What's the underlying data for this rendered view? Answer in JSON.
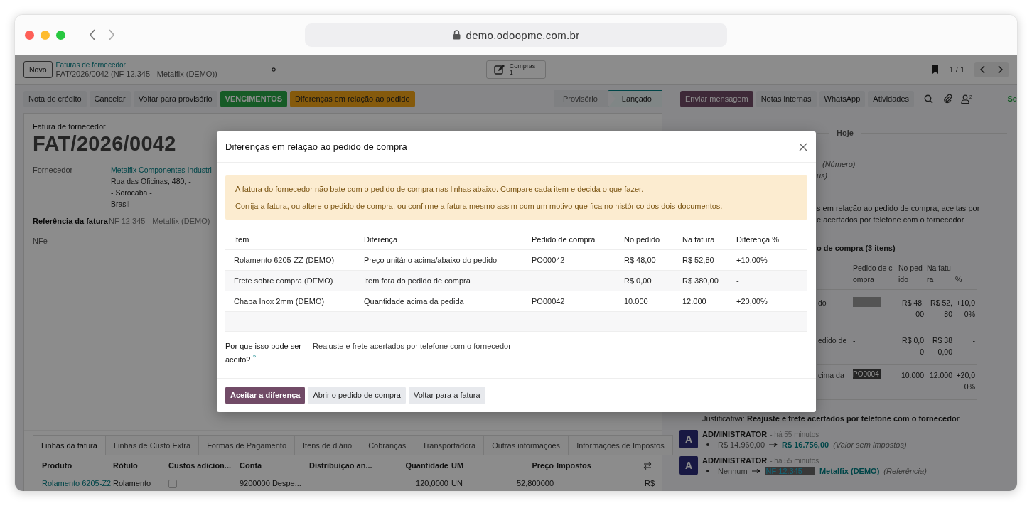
{
  "browser": {
    "url": "demo.odoopme.com.br"
  },
  "control_panel": {
    "new_button": "Novo",
    "breadcrumb": "Faturas de fornecedor",
    "record": "FAT/2026/0042 (NF 12.345 - Metalfix (DEMO))",
    "smart_button": {
      "label": "Compras",
      "count": "1"
    },
    "pager": "1 / 1"
  },
  "actions": [
    {
      "label": "Nota de crédito",
      "kind": "secondary"
    },
    {
      "label": "Cancelar",
      "kind": "secondary"
    },
    {
      "label": "Voltar para provisório",
      "kind": "secondary"
    },
    {
      "label": "VENCIMENTOS",
      "kind": "success"
    },
    {
      "label": "Diferenças em relação ao pedido",
      "kind": "warning"
    }
  ],
  "status_steps": [
    {
      "label": "Provisório",
      "selected": false
    },
    {
      "label": "Lançado",
      "selected": true
    }
  ],
  "chatter_actions": [
    {
      "label": "Enviar mensagem",
      "kind": "primary"
    },
    {
      "label": "Notas internas",
      "kind": "secondary"
    },
    {
      "label": "WhatsApp",
      "kind": "secondary"
    },
    {
      "label": "Atividades",
      "kind": "secondary"
    }
  ],
  "follower_count": "2",
  "follow_label": "Se",
  "form": {
    "type_label": "Fatura de fornecedor",
    "name": "FAT/2026/0042",
    "fields": [
      {
        "label": "Fornecedor",
        "kind": "partner",
        "link": "Metalfix Componentes Industri",
        "lines": [
          "Rua das Oficinas, 480, -",
          "- Sorocaba -",
          "Brasil"
        ]
      },
      {
        "label": "Referência da fatura",
        "kind": "strong",
        "value": "NF 12.345 - Metalfix (DEMO)"
      },
      {
        "label": "NFe",
        "kind": "plain"
      }
    ]
  },
  "notebook": {
    "tabs": [
      {
        "label": "Linhas da fatura",
        "selected": true
      },
      {
        "label": "Linhas de Custo Extra",
        "selected": false
      },
      {
        "label": "Formas de Pagamento",
        "selected": false
      },
      {
        "label": "Itens de diário",
        "selected": false
      },
      {
        "label": "Cobranças",
        "selected": false
      },
      {
        "label": "Transportadora",
        "selected": false
      },
      {
        "label": "Outras informações",
        "selected": false
      },
      {
        "label": "Informações de Impostos",
        "selected": false
      }
    ],
    "columns": [
      "Produto",
      "Rótulo",
      "Custos adicion...",
      "Conta",
      "Distribuição an...",
      "Quantidade",
      "UM",
      "Preço",
      "Impostos"
    ],
    "rows": [
      {
        "product": "Rolamento 6205-Z2",
        "label": "Rolamento",
        "extra_cost": false,
        "account": "9200000 Despe...",
        "quantity": "120,0000",
        "uom": "UN",
        "price": "52,800000",
        "subtotal": "R$"
      }
    ]
  },
  "chatter": {
    "date_divider": "Hoje",
    "fragments": [
      {
        "text": "(Número)",
        "kind": "italic"
      },
      {
        "text": "us)",
        "kind": "italic"
      },
      {
        "text": "s em relação ao pedido de compra, aceitas por",
        "kind": "plain"
      },
      {
        "text": "e acertados por telefone com o fornecedor",
        "kind": "plain"
      },
      {
        "text": "o de compra (3 itens)",
        "kind": "bold"
      }
    ],
    "table": {
      "columns": [
        "Pedido de compra",
        "No pedido",
        "Na fatura",
        "%"
      ],
      "rows": [
        {
          "label": "do",
          "kind": "blank",
          "ordered": "R$ 48,00",
          "invoiced": "R$ 52,80",
          "diff": "+10,00%"
        },
        {
          "label": "edido de",
          "kind": "text",
          "po": "-",
          "ordered": "R$ 0,00",
          "invoiced": "R$ 380,00",
          "diff": "-"
        },
        {
          "label": "cima da",
          "kind": "tag",
          "po": "PO0004",
          "ordered": "10.000",
          "invoiced": "12.000",
          "diff": "+20,00%"
        }
      ]
    },
    "justification_label": "Justificativa:",
    "justification": "Reajuste e frete acertados por telefone com o fornecedor",
    "messages": [
      {
        "avatar": "A",
        "author": "ADMINISTRATOR",
        "time": "- há 55 minutos",
        "old": "R$ 14.960,00",
        "new": "R$ 16.756,00",
        "field": "(Valor sem impostos)"
      },
      {
        "avatar": "A",
        "author": "ADMINISTRATOR",
        "time": "- há 55 minutos",
        "old": "Nenhum",
        "new_highlight": "NF 12.345",
        "new": "Metalfix (DEMO)",
        "field": "(Referência)"
      }
    ]
  },
  "dialog": {
    "title": "Diferenças em relação ao pedido de compra",
    "alert": [
      "A fatura do fornecedor não bate com o pedido de compra nas linhas abaixo. Compare cada item e decida o que fazer.",
      "Corrija a fatura, ou altere o pedido de compra, ou confirme a fatura mesmo assim com um motivo que fica no histórico dos dois documentos."
    ],
    "columns": [
      "Item",
      "Diferença",
      "Pedido de compra",
      "No pedido",
      "Na fatura",
      "Diferença %"
    ],
    "rows": [
      [
        "Rolamento 6205-ZZ (DEMO)",
        "Preço unitário acima/abaixo do pedido",
        "PO00042",
        "R$ 48,00",
        "R$ 52,80",
        "+10,00%"
      ],
      [
        "Frete sobre compra (DEMO)",
        "Item fora do pedido de compra",
        "",
        "R$ 0,00",
        "R$ 380,00",
        "-"
      ],
      [
        "Chapa Inox 2mm (DEMO)",
        "Quantidade acima da pedida",
        "PO00042",
        "10.000",
        "12.000",
        "+20,00%"
      ]
    ],
    "reason_label": "Por que isso pode ser aceito?",
    "reason_help": "?",
    "reason": "Reajuste e frete acertados por telefone com o fornecedor",
    "buttons": [
      {
        "label": "Aceitar a diferença",
        "kind": "primary"
      },
      {
        "label": "Abrir o pedido de compra",
        "kind": "secondary"
      },
      {
        "label": "Voltar para a fatura",
        "kind": "secondary"
      }
    ]
  }
}
